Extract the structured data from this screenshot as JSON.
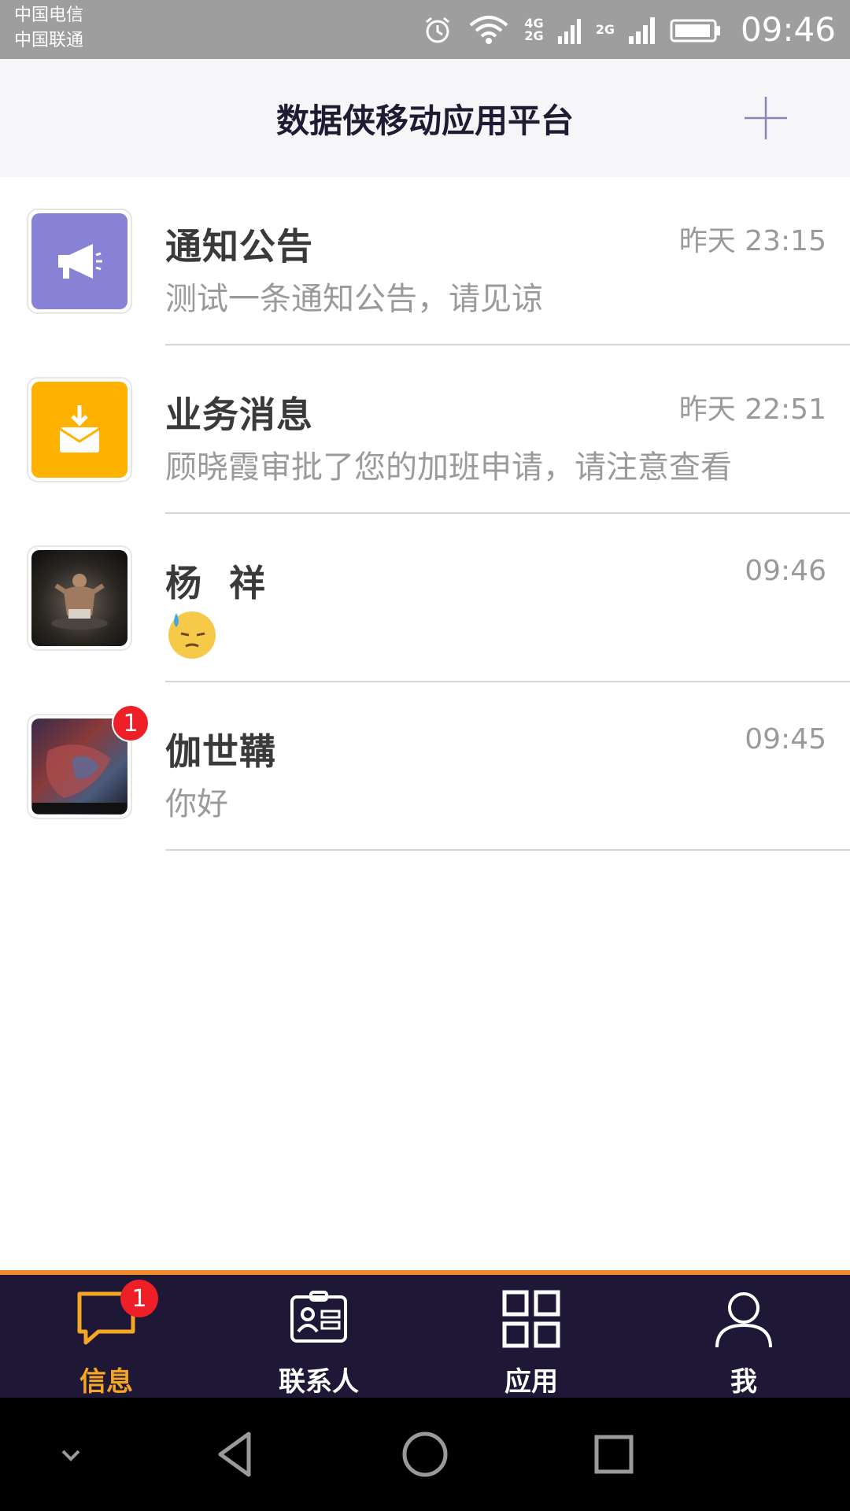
{
  "status_bar": {
    "carrier_1": "中国电信",
    "carrier_2": "中国联通",
    "net_4g": "4G",
    "net_2g_a": "2G",
    "net_2g_b": "2G",
    "time": "09:46"
  },
  "header": {
    "title": "数据侠移动应用平台",
    "add_icon": "plus-icon"
  },
  "conversations": [
    {
      "name": "通知公告",
      "time": "昨天 23:15",
      "preview": "测试一条通知公告，请见谅",
      "avatar_icon": "megaphone-icon",
      "avatar_color": "#8882d6",
      "unread": null
    },
    {
      "name": "业务消息",
      "time": "昨天 22:51",
      "preview": "顾晓霞审批了您的加班申请，请注意查看",
      "avatar_icon": "download-mail-icon",
      "avatar_color": "#ffb100",
      "unread": null
    },
    {
      "name": "杨  祥",
      "time": "09:46",
      "preview": "",
      "preview_icon": "sweat-emoji-icon",
      "avatar_icon": "photo-avatar",
      "unread": null
    },
    {
      "name": "伽世鞲",
      "time": "09:45",
      "preview": "你好",
      "avatar_icon": "photo-avatar",
      "unread": "1"
    }
  ],
  "tabs": [
    {
      "label": "信息",
      "icon": "chat-bubble-icon",
      "badge": "1",
      "active": true
    },
    {
      "label": "联系人",
      "icon": "contact-card-icon",
      "active": false
    },
    {
      "label": "应用",
      "icon": "grid-icon",
      "active": false
    },
    {
      "label": "我",
      "icon": "person-icon",
      "active": false
    }
  ],
  "colors": {
    "tab_bar_bg": "#1f1736",
    "tab_active": "#f5a623",
    "badge_red": "#ee1f26",
    "accent_line": "#f08a2c"
  }
}
